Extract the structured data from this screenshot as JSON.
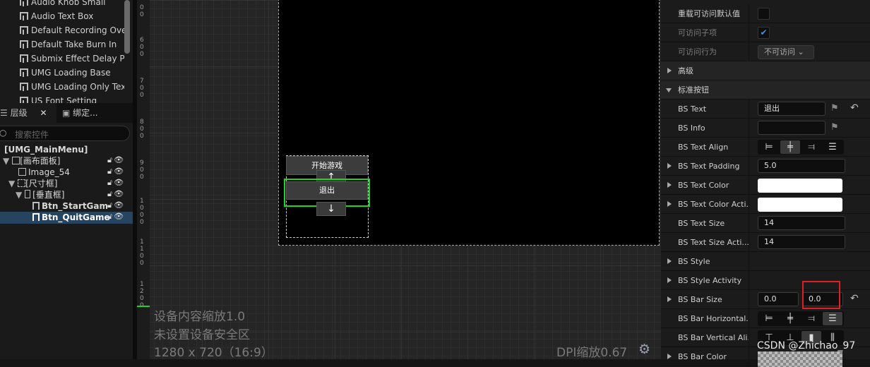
{
  "assets": [
    "Audio Knob Small",
    "Audio Text Box",
    "Default Recording Ove",
    "Default Take Burn In",
    "Submix Effect Delay Pr",
    "UMG Loading Base",
    "UMG Loading Only Tex",
    "US Font Setting"
  ],
  "tabs": {
    "hierarchy": "层级",
    "bind": "绑定..."
  },
  "search_placeholder": "搜索控件",
  "tree": {
    "root": "[UMG_MainMenu]",
    "canvas": "[画布面板]",
    "image": "Image_54",
    "sizebox": "[尺寸框]",
    "vbox": "[垂直框]",
    "btn_start": "Btn_StartGame",
    "btn_quit": "Btn_QuitGame"
  },
  "ruler": [
    "0",
    "0",
    "6",
    "0",
    "0",
    "7",
    "0",
    "0",
    "8",
    "0",
    "0",
    "9",
    "0",
    "0",
    "1",
    "0",
    "0",
    "0",
    "1",
    "1",
    "0",
    "0",
    "1",
    "2",
    "0",
    "0"
  ],
  "canvas": {
    "start_btn": "开始游戏",
    "quit_btn": "退出",
    "up": "↑",
    "down": "↓",
    "info1": "设备内容缩放1.0",
    "info2": "未设置设备安全区",
    "info3": "1280 x 720（16:9）",
    "dpi": "DPI缩放0.67"
  },
  "details": [
    {
      "label": "重载可访问默认值",
      "type": "check",
      "checked": false
    },
    {
      "label": "可访问子项",
      "type": "check",
      "checked": true,
      "dim": true
    },
    {
      "label": "可访问行为",
      "type": "combo",
      "value": "不可访问",
      "dim": true
    },
    {
      "label": "高级",
      "type": "section",
      "expand": "right"
    },
    {
      "label": "标准按钮",
      "type": "section",
      "expand": "down"
    },
    {
      "label": "BS Text",
      "type": "text",
      "value": "退出",
      "flag": true,
      "reset": true
    },
    {
      "label": "BS Info",
      "type": "text",
      "value": "",
      "flag": true
    },
    {
      "label": "BS Text Align",
      "type": "align"
    },
    {
      "label": "BS Text Padding",
      "type": "text",
      "value": "5.0",
      "expand": "right"
    },
    {
      "label": "BS Text Color",
      "type": "color",
      "expand": "right"
    },
    {
      "label": "BS Text Color Acti...",
      "type": "color",
      "expand": "right"
    },
    {
      "label": "BS Text Size",
      "type": "text",
      "value": "14"
    },
    {
      "label": "BS Text Size Acti...",
      "type": "text",
      "value": "14"
    },
    {
      "label": "BS Style",
      "type": "none",
      "expand": "right"
    },
    {
      "label": "BS Style Activity",
      "type": "none",
      "expand": "right"
    },
    {
      "label": "BS Bar Size",
      "type": "vec2",
      "v1": "0.0",
      "v2": "0.0",
      "expand": "right",
      "reset": true
    },
    {
      "label": "BS Bar Horizontal...",
      "type": "align2"
    },
    {
      "label": "BS Bar Vertical Ali...",
      "type": "valign"
    },
    {
      "label": "BS Bar Color",
      "type": "color2",
      "expand": "right"
    }
  ],
  "watermark": "CSDN @Zhichao_97",
  "colors": {
    "selection_green": "#22d422",
    "highlight_red": "#e02020",
    "tree_selection": "#26445f"
  }
}
